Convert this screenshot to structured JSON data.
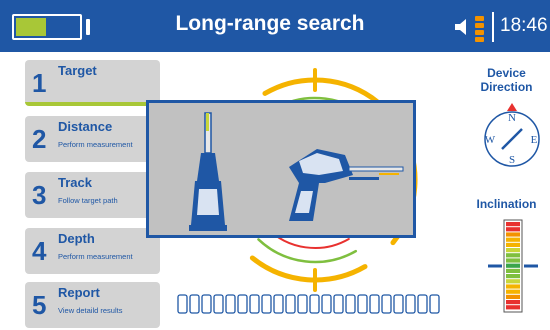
{
  "header": {
    "title": "Long-range search",
    "time": "18:46",
    "battery_level": 0.4,
    "signal_bars": 4,
    "colors": {
      "bar": "#1f57a5",
      "battery": "#a8c737",
      "signal": "#f39200"
    },
    "icons": [
      "battery-icon",
      "speaker-icon",
      "signal-icon"
    ]
  },
  "menu": {
    "items": [
      {
        "number": "1",
        "title": "Target",
        "subtitle": "",
        "active": true
      },
      {
        "number": "2",
        "title": "Distance",
        "subtitle": "Perform measurement",
        "active": false
      },
      {
        "number": "3",
        "title": "Track",
        "subtitle": "Follow target path",
        "active": false
      },
      {
        "number": "4",
        "title": "Depth",
        "subtitle": "Perform measurement",
        "active": false
      },
      {
        "number": "5",
        "title": "Report",
        "subtitle": "View detaild results",
        "active": false
      }
    ],
    "accent": "#a8c737"
  },
  "main": {
    "target_ring_colors": [
      "#f5b300",
      "#7fbf3f",
      "#e8312f"
    ],
    "progress_segments": 22,
    "progress_filled": 0
  },
  "right_panel": {
    "direction_label": "Device Direction",
    "compass": {
      "north": "N",
      "east": "E",
      "south": "S",
      "west": "W"
    },
    "inclination_label": "Inclination"
  }
}
